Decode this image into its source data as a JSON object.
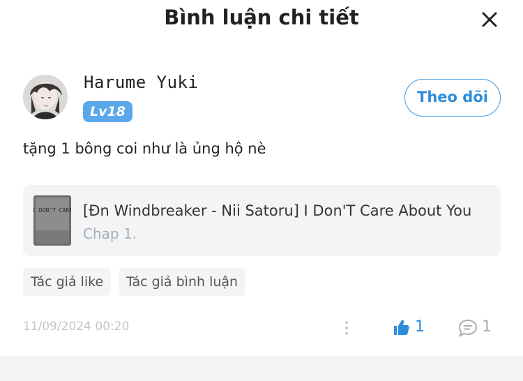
{
  "header": {
    "title": "Bình luận chi tiết",
    "close_icon": "close-icon"
  },
  "user": {
    "name": "Harume Yuki",
    "level": "Lv18",
    "follow_label": "Theo dõi",
    "avatar_icon": "avatar"
  },
  "comment": {
    "text": "tặng 1 bông coi như là ủng hộ nè"
  },
  "story": {
    "title": "[Đn Windbreaker - Nii Satoru] I Don'T Care About You",
    "chapter": "Chap 1.",
    "cover_text": "I DON'T CARE"
  },
  "tags": [
    "Tác giả like",
    "Tác giả bình luận"
  ],
  "footer": {
    "timestamp": "11/09/2024 00:20",
    "like_count": "1",
    "reply_count": "1",
    "more_icon": "more-vertical-icon",
    "like_icon": "thumbs-up-icon",
    "reply_icon": "comment-bubble-icon"
  },
  "colors": {
    "accent": "#2d8ddc",
    "level_badge": "#5aa8ea",
    "muted": "#a9aeb4",
    "card_bg": "#f3f4f6"
  }
}
